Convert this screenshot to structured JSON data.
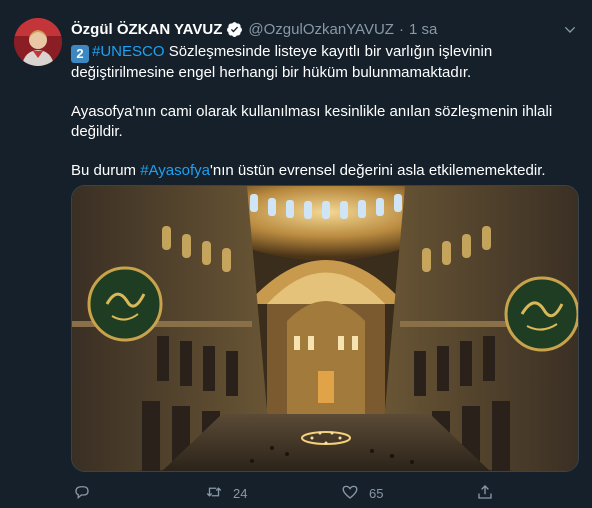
{
  "author": {
    "name": "Özgül ÖZKAN YAVUZ",
    "handle": "@OzgulOzkanYAVUZ",
    "separator": "·",
    "time": "1 sa"
  },
  "tweet": {
    "line1_badge": "2",
    "line1_hashtag": "#UNESCO",
    "line1_rest": " Sözleşmesinde listeye kayıtlı bir varlığın işlevinin değiştirilmesine engel herhangi bir hüküm bulunmamaktadır.",
    "paragraph2": "Ayasofya'nın cami olarak kullanılması kesinlikle anılan sözleşmenin ihlali değildir.",
    "p3_before": "Bu durum ",
    "p3_hashtag": "#Ayasofya",
    "p3_after": "'nın üstün evrensel değerini asla etkilememektedir."
  },
  "actions": {
    "reply_count": "",
    "retweet_count": "24",
    "like_count": "65"
  },
  "icons": {
    "verified": "verified-badge-icon",
    "more": "chevron-down-icon",
    "reply": "reply-icon",
    "retweet": "retweet-icon",
    "like": "heart-icon",
    "share": "share-icon"
  },
  "colors": {
    "background": "#15202b",
    "link": "#1da1f2",
    "secondary_text": "#8899a6"
  }
}
